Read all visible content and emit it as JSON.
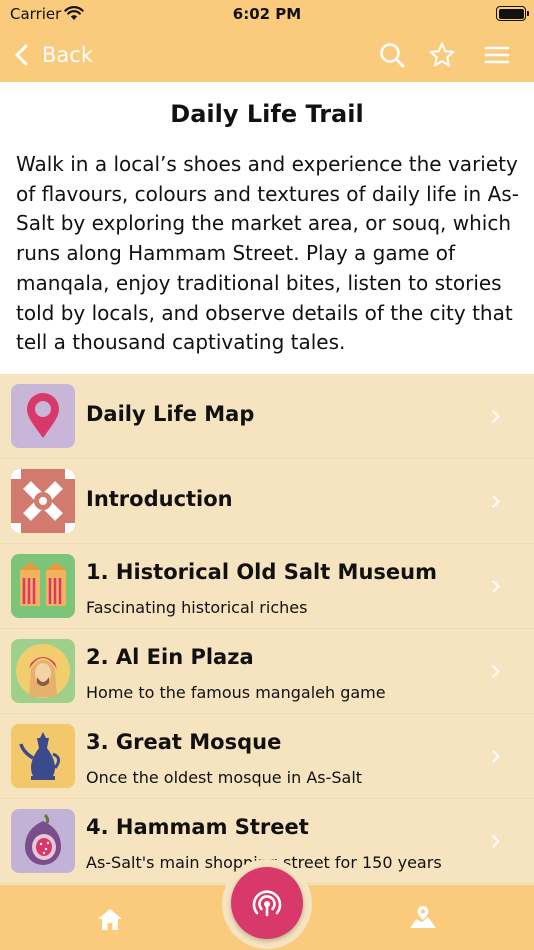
{
  "status_bar": {
    "carrier": "Carrier",
    "time": "6:02 PM"
  },
  "nav": {
    "back_label": "Back",
    "icons": [
      "chevron-left-icon",
      "search-icon",
      "star-icon",
      "menu-icon"
    ]
  },
  "page": {
    "title": "Daily Life Trail",
    "description": "Walk in a local’s shoes and experience the variety of flavours, colours and textures of daily life in As-Salt by exploring the market area, or souq, which runs along Hammam Street.  Play a game of manqala, enjoy traditional bites, listen to stories told by locals, and observe details of the city that tell a thousand captivating tales."
  },
  "items": [
    {
      "title": "Daily Life Map",
      "subtitle": "",
      "icon": "map-pin-icon"
    },
    {
      "title": "Introduction",
      "subtitle": "",
      "icon": "pattern-icon"
    },
    {
      "title": "1. Historical Old Salt Museum",
      "subtitle": "Fascinating historical riches",
      "icon": "museum-icon"
    },
    {
      "title": "2. Al Ein Plaza",
      "subtitle": "Home to the famous mangaleh game",
      "icon": "man-portrait-icon"
    },
    {
      "title": "3. Great Mosque",
      "subtitle": "Once the oldest mosque in As-Salt",
      "icon": "coffee-pot-icon"
    },
    {
      "title": "4. Hammam Street",
      "subtitle": "As-Salt's main shopping street for 150 years",
      "icon": "fig-icon"
    }
  ],
  "tab_bar": {
    "icons": [
      "home-icon",
      "audio-broadcast-icon",
      "map-icon"
    ]
  },
  "colors": {
    "header": "#fbcb7d",
    "list_bg": "#f6e3bf",
    "accent": "#d9386a",
    "icon_fg": "#ffffff"
  }
}
